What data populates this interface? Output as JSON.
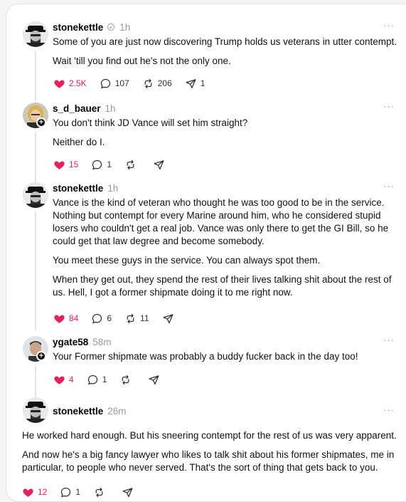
{
  "posts": [
    {
      "username": "stonekettle",
      "time": "1h",
      "more": "···",
      "paragraphs": [
        "Some of you are just now discovering Trump holds us veterans in utter contempt.",
        "Wait 'till you find out he's not the only one."
      ],
      "likes": "2.5K",
      "replies": "107",
      "reposts": "206",
      "shares": "1"
    },
    {
      "username": "s_d_bauer",
      "time": "1h",
      "more": "···",
      "paragraphs": [
        "You don't think JD Vance will set him straight?",
        "Neither do I."
      ],
      "likes": "15",
      "replies": "1",
      "reposts": "",
      "shares": ""
    },
    {
      "username": "stonekettle",
      "time": "1h",
      "more": "···",
      "paragraphs": [
        "Vance is the kind of veteran who thought he was too good to be in the service. Nothing but contempt for every Marine around him, who he considered stupid losers who couldn't get a real job. Vance was only there to get the GI Bill, so he could get that law degree and become somebody.",
        "You meet these guys in the service. You can always spot them.",
        "When they get out, they spend the rest of their lives talking shit about the rest of us. Hell, I got a former shipmate doing it to me right now."
      ],
      "likes": "84",
      "replies": "6",
      "reposts": "11",
      "shares": ""
    },
    {
      "username": "ygate58",
      "time": "58m",
      "more": "···",
      "paragraphs": [
        "Your Former shipmate was probably a buddy fucker back in the day too!"
      ],
      "likes": "4",
      "replies": "1",
      "reposts": "",
      "shares": ""
    },
    {
      "username": "stonekettle",
      "time": "26m",
      "more": "···",
      "paragraphs": [
        "He worked hard enough. But his sneering contempt for the rest of us was very apparent.",
        "And now he's a big fancy lawyer who likes to talk shit about his former shipmates, me in particular, to people who never served. That's the sort of thing that gets back to you."
      ],
      "likes": "12",
      "replies": "1",
      "reposts": "",
      "shares": ""
    }
  ],
  "colors": {
    "like": "#e0245e",
    "meta": "#999999",
    "thread_line": "#e5e5e5"
  },
  "icons": {
    "like": "heart-icon",
    "reply": "comment-icon",
    "repost": "repost-icon",
    "share": "send-icon",
    "verified": "verified-icon"
  }
}
